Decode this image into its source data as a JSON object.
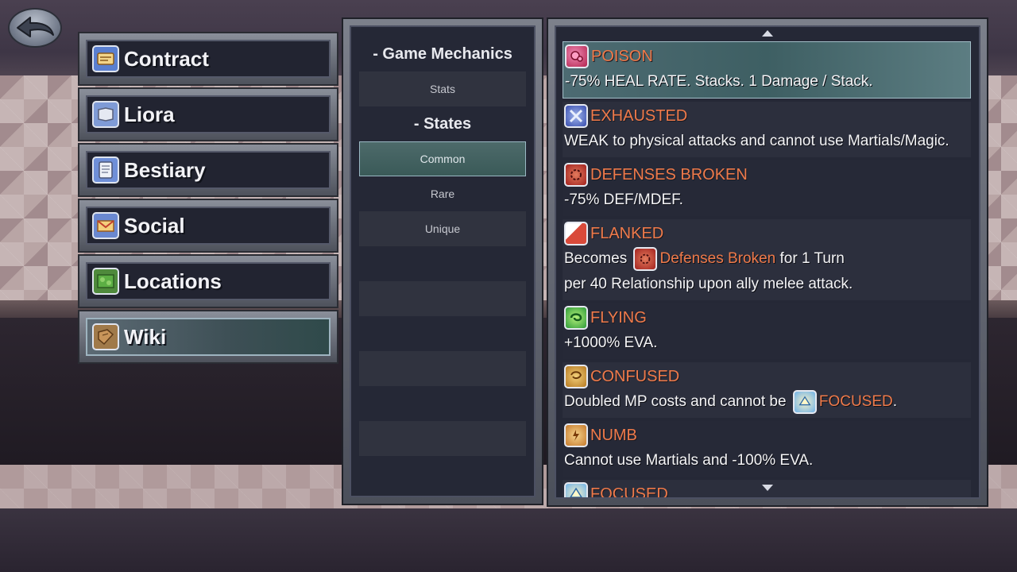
{
  "menu": {
    "items": [
      {
        "label": "Contract",
        "icon": "contract-icon"
      },
      {
        "label": "Liora",
        "icon": "book-icon"
      },
      {
        "label": "Bestiary",
        "icon": "scroll-icon"
      },
      {
        "label": "Social",
        "icon": "letter-icon"
      },
      {
        "label": "Locations",
        "icon": "map-icon"
      },
      {
        "label": "Wiki",
        "icon": "wiki-book-icon"
      }
    ],
    "active": "Wiki"
  },
  "categories": {
    "game_mechanics": "- Game Mechanics",
    "stats": "Stats",
    "states": "- States",
    "common": "Common",
    "rare": "Rare",
    "unique": "Unique",
    "selected": "Common"
  },
  "states": [
    {
      "name": "POISON",
      "desc": "-75% HEAL RATE. Stacks. 1 Damage / Stack.",
      "icon": "poison-icon"
    },
    {
      "name": "EXHAUSTED",
      "desc": "WEAK to physical attacks and cannot use Martials/Magic.",
      "icon": "exhausted-icon"
    },
    {
      "name": "DEFENSES BROKEN",
      "desc": "-75% DEF/MDEF.",
      "icon": "defenses-broken-icon"
    },
    {
      "name": "FLANKED",
      "desc_pre": "Becomes",
      "desc_link": "Defenses Broken",
      "desc_post": "for 1 Turn",
      "desc2": "per 40 Relationship upon ally melee attack.",
      "icon": "flanked-icon"
    },
    {
      "name": "FLYING",
      "desc": "+1000% EVA.",
      "icon": "flying-icon"
    },
    {
      "name": "CONFUSED",
      "desc_pre": "Doubled MP costs and cannot be",
      "desc_link": "FOCUSED",
      "desc_post": ".",
      "icon": "confused-icon"
    },
    {
      "name": "NUMB",
      "desc": "Cannot use Martials and -100% EVA.",
      "icon": "numb-icon"
    },
    {
      "name": "FOCUSED",
      "icon": "focused-icon"
    }
  ],
  "colors": {
    "state_name": "#ef7a4a",
    "panel_bg": "#252836",
    "selection": "#3e5f63"
  }
}
